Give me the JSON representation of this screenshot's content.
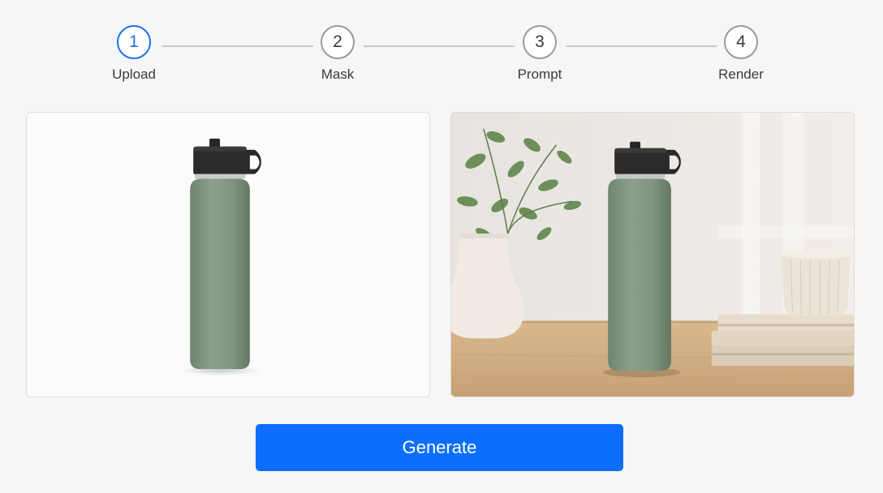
{
  "stepper": {
    "steps": [
      {
        "number": "1",
        "label": "Upload",
        "state": "active"
      },
      {
        "number": "2",
        "label": "Mask",
        "state": "inactive"
      },
      {
        "number": "3",
        "label": "Prompt",
        "state": "inactive"
      },
      {
        "number": "4",
        "label": "Render",
        "state": "inactive"
      }
    ]
  },
  "preview": {
    "original_image": "green-water-bottle-white-background",
    "rendered_image": "green-water-bottle-on-wooden-table-with-plant-vase-books-cup"
  },
  "actions": {
    "generate_label": "Generate"
  },
  "colors": {
    "accent": "#1a73e8",
    "button": "#0d6efd",
    "bottle": "#7f9580",
    "cap": "#2a2a2a"
  }
}
